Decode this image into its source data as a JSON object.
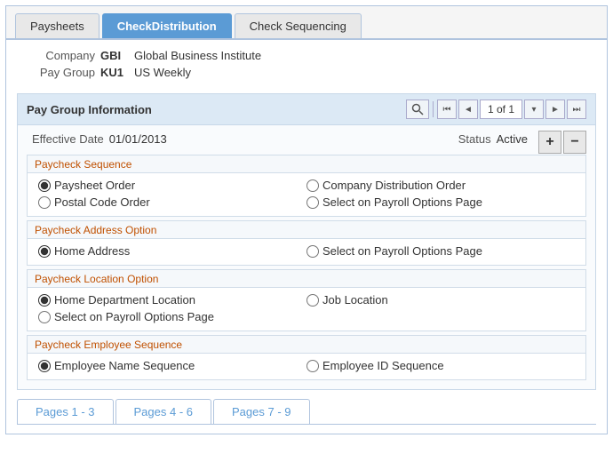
{
  "tabs": [
    {
      "id": "paysheets",
      "label": "Paysheets",
      "active": false
    },
    {
      "id": "check-distribution",
      "label": "CheckDistribution",
      "active": true
    },
    {
      "id": "check-sequencing",
      "label": "Check Sequencing",
      "active": false
    }
  ],
  "company": {
    "label": "Company",
    "code": "GBI",
    "description": "Global Business Institute"
  },
  "paygroup": {
    "label": "Pay Group",
    "code": "KU1",
    "description": "US Weekly"
  },
  "section": {
    "title": "Pay Group Information",
    "page_indicator": "1 of 1"
  },
  "effective_date": {
    "label": "Effective Date",
    "value": "01/01/2013"
  },
  "status": {
    "label": "Status",
    "value": "Active"
  },
  "add_button": "+",
  "remove_button": "−",
  "subsections": [
    {
      "id": "paycheck-sequence",
      "title": "Paycheck Sequence",
      "rows": [
        [
          {
            "id": "paysheet-order",
            "label": "Paysheet Order",
            "checked": true
          },
          {
            "id": "company-dist-order",
            "label": "Company Distribution Order",
            "checked": false
          }
        ],
        [
          {
            "id": "postal-code-order",
            "label": "Postal Code Order",
            "checked": false
          },
          {
            "id": "select-payroll-options-1",
            "label": "Select on Payroll Options Page",
            "checked": false
          }
        ]
      ]
    },
    {
      "id": "paycheck-address",
      "title": "Paycheck Address Option",
      "rows": [
        [
          {
            "id": "home-address",
            "label": "Home Address",
            "checked": true
          },
          {
            "id": "select-payroll-options-2",
            "label": "Select on Payroll Options Page",
            "checked": false
          }
        ]
      ]
    },
    {
      "id": "paycheck-location",
      "title": "Paycheck Location Option",
      "rows": [
        [
          {
            "id": "home-dept-location",
            "label": "Home Department Location",
            "checked": true
          },
          {
            "id": "job-location",
            "label": "Job Location",
            "checked": false
          }
        ],
        [
          {
            "id": "select-payroll-options-3",
            "label": "Select on Payroll Options Page",
            "checked": false,
            "full": true
          }
        ]
      ]
    },
    {
      "id": "paycheck-employee-seq",
      "title": "Paycheck Employee Sequence",
      "rows": [
        [
          {
            "id": "employee-name-seq",
            "label": "Employee Name Sequence",
            "checked": true
          },
          {
            "id": "employee-id-seq",
            "label": "Employee ID Sequence",
            "checked": false
          }
        ]
      ]
    }
  ],
  "bottom_tabs": [
    {
      "id": "pages-1-3",
      "label": "Pages 1 - 3"
    },
    {
      "id": "pages-4-6",
      "label": "Pages 4 - 6"
    },
    {
      "id": "pages-7-9",
      "label": "Pages 7 - 9"
    }
  ]
}
